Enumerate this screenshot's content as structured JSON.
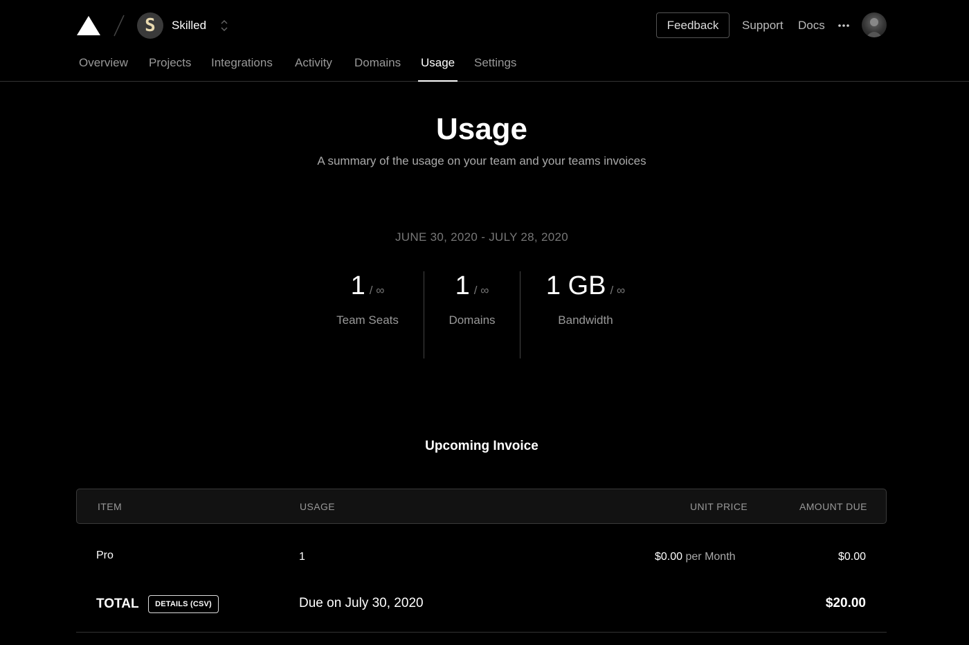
{
  "header": {
    "team_initial": "S",
    "team_name": "Skilled",
    "feedback_label": "Feedback",
    "support_label": "Support",
    "docs_label": "Docs"
  },
  "tabs": [
    {
      "label": "Overview"
    },
    {
      "label": "Projects"
    },
    {
      "label": "Integrations"
    },
    {
      "label": "Activity"
    },
    {
      "label": "Domains"
    },
    {
      "label": "Usage",
      "active": true
    },
    {
      "label": "Settings"
    }
  ],
  "page": {
    "title": "Usage",
    "subtitle": "A summary of the usage on your team and your teams invoices",
    "period": "JUNE 30, 2020 - JULY 28, 2020"
  },
  "stats": [
    {
      "value": "1",
      "limit": "/ ∞",
      "label": "Team Seats"
    },
    {
      "value": "1",
      "limit": "/ ∞",
      "label": "Domains"
    },
    {
      "value": "1 GB",
      "limit": "/ ∞",
      "label": "Bandwidth"
    }
  ],
  "invoice": {
    "title": "Upcoming Invoice",
    "columns": [
      "ITEM",
      "USAGE",
      "UNIT PRICE",
      "AMOUNT DUE"
    ],
    "rows": [
      {
        "item": "Pro",
        "usage": "1",
        "unit_price": "$0.00",
        "unit_period": "per Month",
        "amount": "$0.00"
      }
    ],
    "total_label": "TOTAL",
    "details_label": "DETAILS (CSV)",
    "due_text": "Due on July 30, 2020",
    "total_amount": "$20.00"
  },
  "colors": {
    "background": "#000000",
    "text": "#ffffff",
    "muted": "#999999",
    "border": "#333333"
  }
}
